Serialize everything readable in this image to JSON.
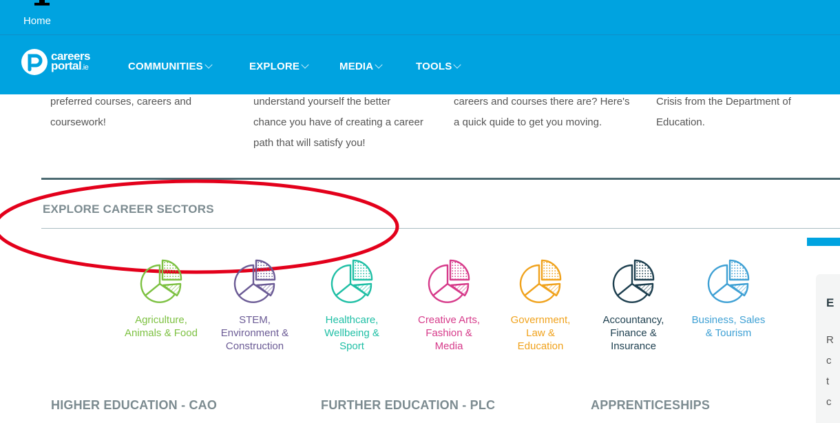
{
  "header": {
    "home_link": "Home",
    "logo_line1": "careers",
    "logo_line2": "portal",
    "logo_tld": ".ie",
    "nav": [
      {
        "label": "COMMUNITIES"
      },
      {
        "label": "EXPLORE"
      },
      {
        "label": "MEDIA"
      },
      {
        "label": "TOOLS"
      }
    ],
    "bar_color": "#00a3e0"
  },
  "intro_columns": [
    {
      "lines": [
        "preferred courses, careers and",
        "coursework!"
      ]
    },
    {
      "lines": [
        "understand yourself the better",
        "chance you have of creating a career",
        "path that will satisfy you!"
      ]
    },
    {
      "lines": [
        "careers and courses there are? Here's",
        "a quick quide to get you moving."
      ]
    },
    {
      "lines": [
        "Crisis from the Department of",
        "Education."
      ]
    }
  ],
  "section_title": "EXPLORE CAREER SECTORS",
  "sectors": [
    {
      "label": "Agriculture, Animals & Food",
      "lines": [
        "Agriculture,",
        "Animals & Food"
      ],
      "color": "#7dc142",
      "icon": "pie-chart-icon"
    },
    {
      "label": "STEM, Environment & Construction",
      "lines": [
        "STEM,",
        "Environment &",
        "Construction"
      ],
      "color": "#6b5b95",
      "icon": "pie-chart-icon"
    },
    {
      "label": "Healthcare, Wellbeing & Sport",
      "lines": [
        "Healthcare,",
        "Wellbeing &",
        "Sport"
      ],
      "color": "#1fbfa5",
      "icon": "pie-chart-icon"
    },
    {
      "label": "Creative Arts, Fashion & Media",
      "lines": [
        "Creative Arts,",
        "Fashion &",
        "Media"
      ],
      "color": "#d63a8a",
      "icon": "pie-chart-icon"
    },
    {
      "label": "Government, Law & Education",
      "lines": [
        "Government,",
        "Law &",
        "Education"
      ],
      "color": "#f0a21c",
      "icon": "pie-chart-icon"
    },
    {
      "label": "Accountancy, Finance & Insurance",
      "lines": [
        "Accountancy,",
        "Finance &",
        "Insurance"
      ],
      "color": "#1d3f4f",
      "icon": "pie-chart-icon"
    },
    {
      "label": "Business, Sales & Tourism",
      "lines": [
        "Business, Sales",
        "& Tourism"
      ],
      "color": "#3ea0d4",
      "icon": "pie-chart-icon"
    }
  ],
  "right_card": {
    "title_fragment": "E",
    "text_fragments": [
      "R",
      "c",
      "t",
      "c"
    ]
  },
  "bottom_headings": [
    "HIGHER EDUCATION - CAO",
    "FURTHER EDUCATION - PLC",
    "APPRENTICESHIPS"
  ],
  "annotation_color": "#e3001b"
}
